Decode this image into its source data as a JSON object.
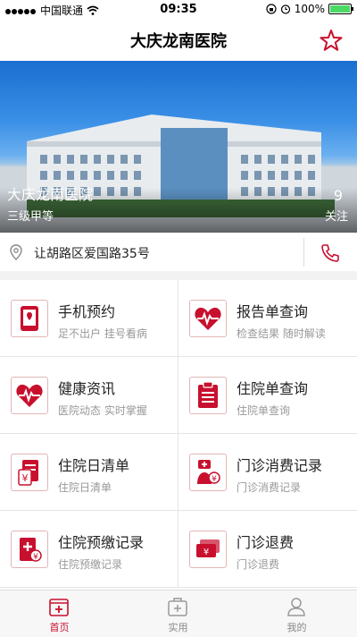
{
  "status_bar": {
    "carrier": "中国联通",
    "time": "09:35",
    "battery": "100%"
  },
  "nav": {
    "title": "大庆龙南医院"
  },
  "banner": {
    "name": "大庆龙南医院",
    "grade": "三级甲等",
    "follow_count": "9",
    "follow_label": "关注"
  },
  "address": {
    "text": "让胡路区爱国路35号"
  },
  "services": [
    {
      "title": "手机预约",
      "subtitle": "足不出户 挂号看病",
      "icon": "phone-booking-icon"
    },
    {
      "title": "报告单查询",
      "subtitle": "检查结果 随时解读",
      "icon": "heartbeat-icon"
    },
    {
      "title": "健康资讯",
      "subtitle": "医院动态 实时掌握",
      "icon": "heartbeat-icon"
    },
    {
      "title": "住院单查询",
      "subtitle": "住院单查询",
      "icon": "clipboard-icon"
    },
    {
      "title": "住院日清单",
      "subtitle": "住院日清单",
      "icon": "daily-list-icon"
    },
    {
      "title": "门诊消费记录",
      "subtitle": "门诊消费记录",
      "icon": "clinic-payment-icon"
    },
    {
      "title": "住院预缴记录",
      "subtitle": "住院预缴记录",
      "icon": "prepay-icon"
    },
    {
      "title": "门诊退费",
      "subtitle": "门诊退费",
      "icon": "refund-icon"
    }
  ],
  "tabs": [
    {
      "label": "首页",
      "icon": "home-icon",
      "active": true
    },
    {
      "label": "实用",
      "icon": "medkit-icon",
      "active": false
    },
    {
      "label": "我的",
      "icon": "user-icon",
      "active": false
    }
  ],
  "colors": {
    "accent": "#c8102e",
    "battery": "#4cd964"
  }
}
